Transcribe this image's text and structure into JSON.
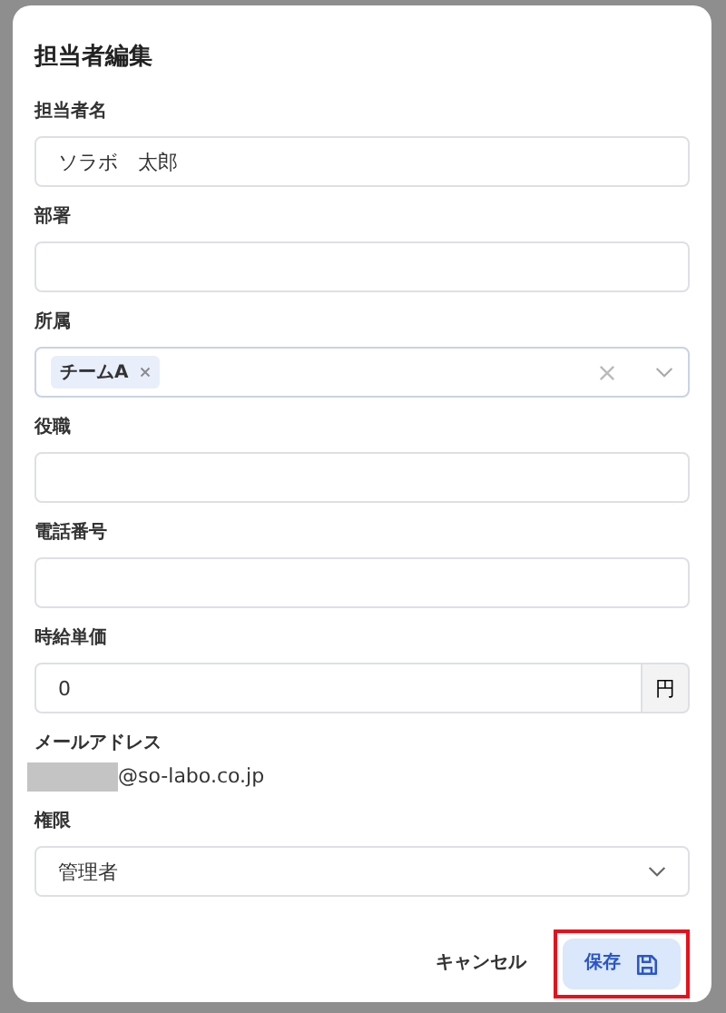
{
  "dialog": {
    "title": "担当者編集"
  },
  "fields": [
    {
      "kind": "text",
      "label": "担当者名",
      "value": "ソラボ　太郎"
    },
    {
      "kind": "text",
      "label": "部署"
    },
    {
      "kind": "tags",
      "label": "所属",
      "tags": [
        "チームA"
      ]
    },
    {
      "kind": "text",
      "label": "役職"
    },
    {
      "kind": "text",
      "label": "電話番号"
    },
    {
      "kind": "suffix",
      "label": "時給単価",
      "value": "0",
      "suffix": "円"
    },
    {
      "kind": "static",
      "label": "メールアドレス",
      "redacted": true,
      "value": "@so-labo.co.jp"
    },
    {
      "kind": "select",
      "label": "権限",
      "value": "管理者"
    }
  ],
  "buttons": [
    {
      "kind": "cancel",
      "label": "キャンセル",
      "highlighted": false
    },
    {
      "kind": "save",
      "label": "保存",
      "highlighted": true
    }
  ]
}
